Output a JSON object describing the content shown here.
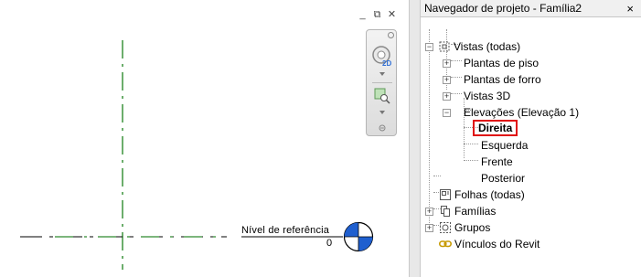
{
  "canvas": {
    "window_controls": {
      "minimize": "_",
      "restore": "⧉",
      "close": "✕"
    },
    "nav_bar": {
      "wheel_label": "2D"
    },
    "level": {
      "name": "Nível de referência",
      "elevation": "0"
    }
  },
  "browser": {
    "title": "Navegador de projeto - Família2",
    "close": "×",
    "tree": {
      "views": "Vistas (todas)",
      "floor_plans": "Plantas de piso",
      "ceiling_plans": "Plantas de forro",
      "views_3d": "Vistas 3D",
      "elevations": "Elevações (Elevação 1)",
      "elevation_items": [
        "Direita",
        "Esquerda",
        "Frente",
        "Posterior"
      ],
      "sheets": "Folhas (todas)",
      "families": "Famílias",
      "groups": "Grupos",
      "links": "Vínculos do Revit"
    }
  },
  "colors": {
    "reference_line": "#2e8b2e",
    "selection": "#e01010",
    "elevation_marker": "#1f5fcf"
  }
}
